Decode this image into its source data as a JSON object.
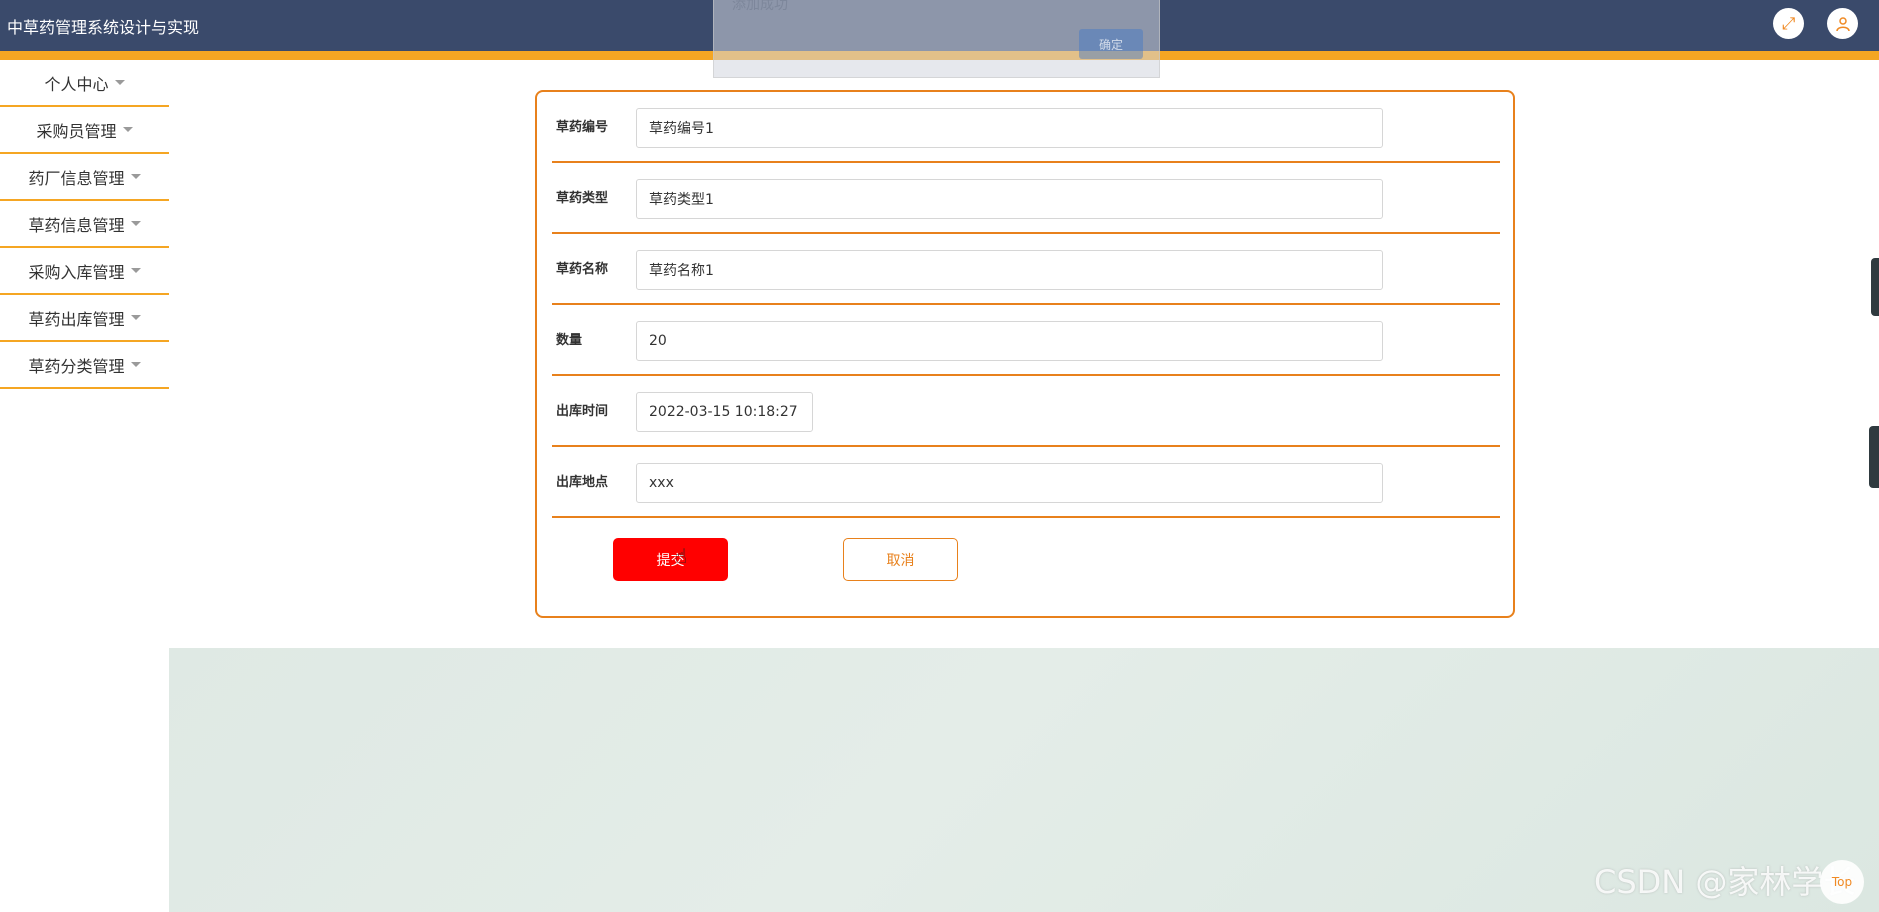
{
  "header": {
    "title": "中草药管理系统设计与实现",
    "fullscreen_icon": "expand-icon",
    "user_icon": "user-icon"
  },
  "toast": {
    "message": "添加成功",
    "confirm_label": "确定"
  },
  "sidebar": {
    "items": [
      {
        "label": "个人中心"
      },
      {
        "label": "采购员管理"
      },
      {
        "label": "药厂信息管理"
      },
      {
        "label": "草药信息管理"
      },
      {
        "label": "采购入库管理"
      },
      {
        "label": "草药出库管理"
      },
      {
        "label": "草药分类管理"
      }
    ]
  },
  "form": {
    "fields": [
      {
        "label": "草药编号",
        "value": "草药编号1"
      },
      {
        "label": "草药类型",
        "value": "草药类型1"
      },
      {
        "label": "草药名称",
        "value": "草药名称1"
      },
      {
        "label": "数量",
        "value": "20"
      },
      {
        "label": "出库时间",
        "value": "2022-03-15 10:18:27"
      },
      {
        "label": "出库地点",
        "value": "xxx"
      }
    ],
    "submit_label": "提交",
    "cancel_label": "取消"
  },
  "footer": {
    "watermark": "CSDN @家林学长",
    "top_label": "Top"
  },
  "colors": {
    "header_bg": "#3a4a6b",
    "accent_orange": "#e8811c",
    "stripe_yellow": "#f5a623",
    "submit_red": "#ff0000"
  }
}
